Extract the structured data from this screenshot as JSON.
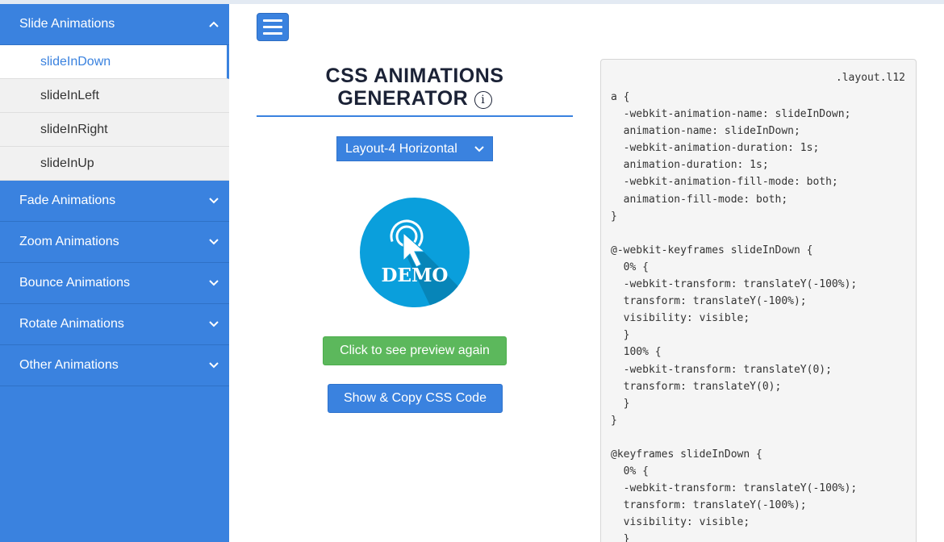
{
  "sidebar": {
    "groups": [
      {
        "label": "Slide Animations",
        "expanded": true,
        "items": [
          "slideInDown",
          "slideInLeft",
          "slideInRight",
          "slideInUp"
        ],
        "active_item": "slideInDown"
      },
      {
        "label": "Fade Animations",
        "expanded": false
      },
      {
        "label": "Zoom Animations",
        "expanded": false
      },
      {
        "label": "Bounce Animations",
        "expanded": false
      },
      {
        "label": "Rotate Animations",
        "expanded": false
      },
      {
        "label": "Other Animations",
        "expanded": false
      }
    ]
  },
  "header": {
    "menu_icon": "hamburger-icon"
  },
  "main": {
    "title_line1": "CSS ANIMATIONS",
    "title_line2": "GENERATOR",
    "info_icon": "info-icon",
    "layout_select": {
      "value": "Layout-4 Horizontal"
    },
    "demo_label": "DEMO",
    "preview_button": "Click to see preview again",
    "copy_button": "Show & Copy CSS Code"
  },
  "code_panel": {
    "label": ".layout.l12",
    "lines": [
      "a {",
      "  -webkit-animation-name: slideInDown;",
      "  animation-name: slideInDown;",
      "  -webkit-animation-duration: 1s;",
      "  animation-duration: 1s;",
      "  -webkit-animation-fill-mode: both;",
      "  animation-fill-mode: both;",
      "}",
      "",
      "@-webkit-keyframes slideInDown {",
      "  0% {",
      "  -webkit-transform: translateY(-100%);",
      "  transform: translateY(-100%);",
      "  visibility: visible;",
      "  }",
      "  100% {",
      "  -webkit-transform: translateY(0);",
      "  transform: translateY(0);",
      "  }",
      "}",
      "",
      "@keyframes slideInDown {",
      "  0% {",
      "  -webkit-transform: translateY(-100%);",
      "  transform: translateY(-100%);",
      "  visibility: visible;",
      "  }"
    ]
  },
  "colors": {
    "primary": "#3a82df",
    "success": "#5cb85c",
    "demo_circle": "#0a9fdc",
    "title": "#1b2236"
  }
}
